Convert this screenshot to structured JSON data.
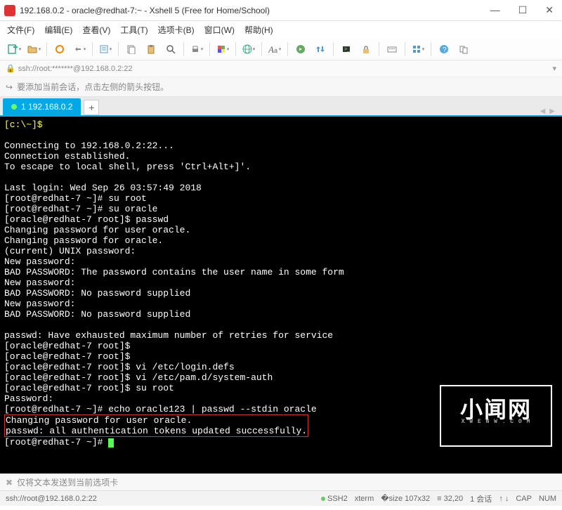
{
  "titlebar": {
    "title": "192.168.0.2 - oracle@redhat-7:~ - Xshell 5 (Free for Home/School)"
  },
  "menubar": {
    "file": "文件(F)",
    "edit": "编辑(E)",
    "view": "查看(V)",
    "tools": "工具(T)",
    "tabs": "选项卡(B)",
    "window": "窗口(W)",
    "help": "帮助(H)"
  },
  "addressbar": {
    "url": "ssh://root:*******@192.168.0.2:22"
  },
  "hintbar": {
    "text": "要添加当前会话，点击左侧的箭头按钮。"
  },
  "tab": {
    "label": "1 192.168.0.2",
    "add": "+"
  },
  "terminal": {
    "prompt_local": "[c:\\~]$",
    "connecting": "Connecting to 192.168.0.2:22...",
    "established": "Connection established.",
    "escape": "To escape to local shell, press 'Ctrl+Alt+]'.",
    "lastlogin": "Last login: Wed Sep 26 03:57:49 2018",
    "p1_prompt": "[root@redhat-7 ~]#",
    "p1_cmd": " su root",
    "p2_prompt": "[root@redhat-7 ~]#",
    "p2_cmd": " su oracle",
    "p3_prompt": "[oracle@redhat-7 root]$",
    "p3_cmd": " passwd",
    "chg1": "Changing password for user oracle.",
    "chg2": "Changing password for oracle.",
    "cur": "(current) UNIX password:",
    "np1": "New password:",
    "bad1": "BAD PASSWORD: The password contains the user name in some form",
    "np2": "New password:",
    "bad2": "BAD PASSWORD: No password supplied",
    "np3": "New password:",
    "bad3": "BAD PASSWORD: No password supplied",
    "exhaust": "passwd: Have exhausted maximum number of retries for service",
    "p4_prompt": "[oracle@redhat-7 root]$",
    "p5_prompt": "[oracle@redhat-7 root]$",
    "p6_prompt": "[oracle@redhat-7 root]$",
    "p6_cmd": " vi /etc/login.defs",
    "p7_prompt": "[oracle@redhat-7 root]$",
    "p7_cmd": " vi /etc/pam.d/system-auth",
    "p8_prompt": "[oracle@redhat-7 root]$",
    "p8_cmd": " su root",
    "pwd": "Password:",
    "p9_prompt": "[root@redhat-7 ~]#",
    "p9_cmd": " echo oracle123 | passwd --stdin oracle",
    "box1": "Changing password for user oracle.",
    "box2": "passwd: all authentication tokens updated successfully.",
    "p10_prompt": "[root@redhat-7 ~]#"
  },
  "watermark": {
    "big": "小闻网",
    "small": "X W E N W . C O M"
  },
  "infobar": {
    "text": "仅将文本发送到当前选项卡"
  },
  "statusbar": {
    "conn": "ssh://root@192.168.0.2:22",
    "ssh": "SSH2",
    "term": "xterm",
    "size": "107x32",
    "pos": "32,20",
    "sessions": "1 会话",
    "cap": "CAP",
    "num": "NUM"
  }
}
